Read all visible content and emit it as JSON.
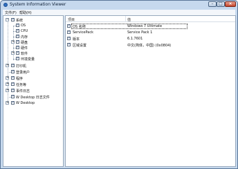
{
  "window": {
    "title": "System Information Viewer"
  },
  "menu": [
    {
      "label": "文件(F)"
    },
    {
      "label": "帮助(H)"
    }
  ],
  "tree": [
    {
      "label": "系统",
      "checked": true,
      "expander": "−"
    },
    {
      "label": "OS",
      "checked": true
    },
    {
      "label": "CPU",
      "checked": true
    },
    {
      "label": "内存",
      "checked": true
    },
    {
      "label": "硬盘",
      "checked": true,
      "expander": "+"
    },
    {
      "label": "硬件",
      "checked": true
    },
    {
      "label": "软件",
      "checked": true,
      "expander": "+"
    },
    {
      "label": "环境变量",
      "checked": true
    },
    {
      "label": "打印机",
      "checked": true,
      "expander": "+"
    },
    {
      "label": "登录用户",
      "checked": true
    },
    {
      "label": "程序",
      "checked": true,
      "expander": "+"
    },
    {
      "label": "任务等",
      "checked": true,
      "expander": "+"
    },
    {
      "label": "事件日志",
      "checked": true,
      "expander": "+"
    },
    {
      "label": "W Desktop 日志文件",
      "checked": true
    },
    {
      "label": "W Desktop",
      "checked": true,
      "expander": "+"
    }
  ],
  "list": {
    "columns": [
      "项目",
      "值"
    ],
    "rows": [
      {
        "item": "OS 名称",
        "value": "Windows 7 Ultimate",
        "checked": true
      },
      {
        "item": "ServicePack",
        "value": "Service Pack 1",
        "checked": true
      },
      {
        "item": "版本",
        "value": "6.1.7601",
        "checked": true
      },
      {
        "item": "区域设置",
        "value": "中文(简体，中国) (0x0804)",
        "checked": true
      }
    ]
  }
}
